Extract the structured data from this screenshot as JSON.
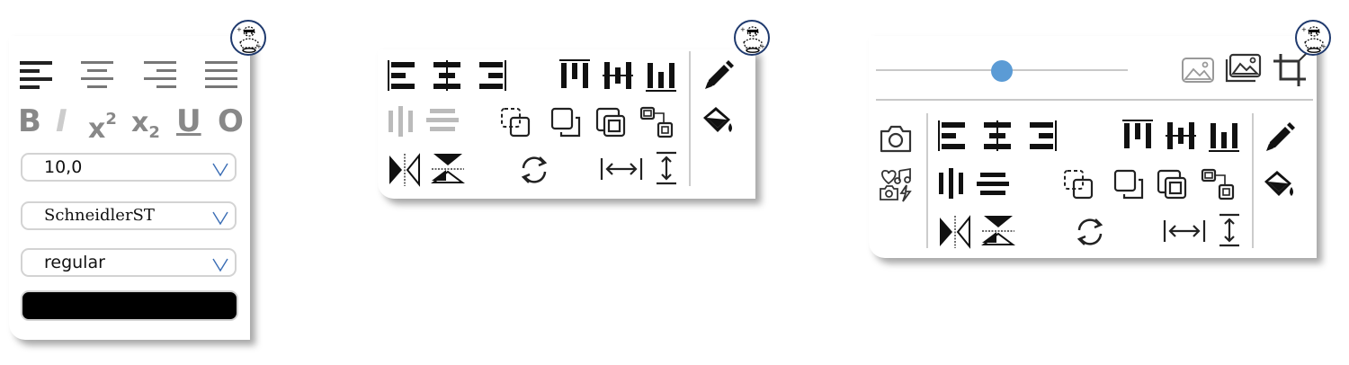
{
  "text_panel": {
    "bold_label": "B",
    "italic_label": "I",
    "superscript_base": "x",
    "superscript_exp": "2",
    "subscript_base": "x",
    "subscript_exp": "2",
    "underline_label": "U",
    "overline_label": "O",
    "font_size": "10,0",
    "font_family": "SchneidlerST",
    "font_weight": "regular",
    "color": "#000000"
  },
  "image_panel": {
    "slider_value": 0.5,
    "accent_color": "#5b9bd5"
  },
  "colors": {
    "badge_border": "#1f3a6e",
    "active_icon": "#111111",
    "disabled_icon": "#b8b8b8"
  },
  "icons": [
    "align-left-icon",
    "align-center-icon",
    "align-right-icon",
    "justify-icon",
    "align-objects-left-icon",
    "align-objects-center-icon",
    "align-objects-right-icon",
    "align-objects-top-icon",
    "align-objects-middle-icon",
    "align-objects-bottom-icon",
    "distribute-horizontal-icon",
    "distribute-vertical-icon",
    "bring-forward-icon",
    "send-backward-icon",
    "bring-to-front-icon",
    "group-icon",
    "flip-horizontal-icon",
    "flip-vertical-icon",
    "rotate-icon",
    "fit-width-icon",
    "fit-height-icon",
    "pencil-icon",
    "paint-bucket-icon",
    "image-icon",
    "images-icon",
    "crop-icon",
    "camera-icon",
    "media-icon",
    "assistant-badge-icon"
  ]
}
